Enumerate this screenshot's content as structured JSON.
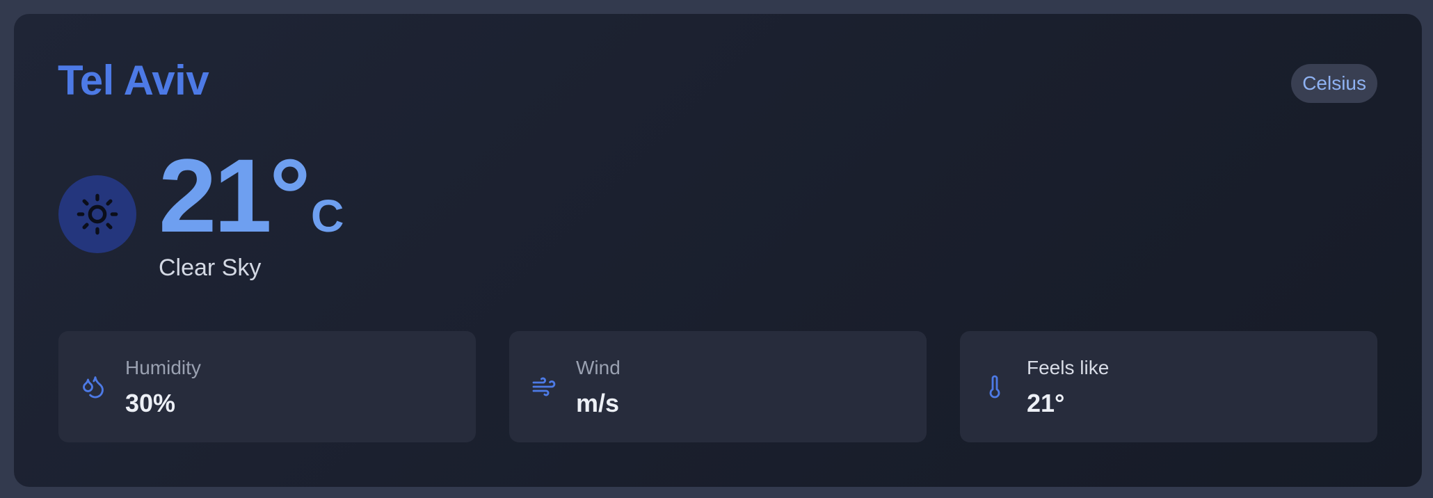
{
  "location": {
    "city": "Tel Aviv"
  },
  "unit_toggle": {
    "label": "Celsius"
  },
  "current": {
    "temperature": "21°",
    "unit": "C",
    "condition": "Clear Sky",
    "icon": "sun-icon"
  },
  "stats": {
    "humidity": {
      "label": "Humidity",
      "value": "30%",
      "icon": "droplets-icon"
    },
    "wind": {
      "label": "Wind",
      "value": "m/s",
      "icon": "wind-icon"
    },
    "feels_like": {
      "label": "Feels like",
      "value": "21°",
      "icon": "thermometer-icon"
    }
  },
  "colors": {
    "accent": "#4d7ae6",
    "temperature": "#6e9ff0",
    "icon_circle": "#24367d",
    "card_background": "#1c2130",
    "stat_background": "#272c3c",
    "page_background": "#333a4e"
  }
}
